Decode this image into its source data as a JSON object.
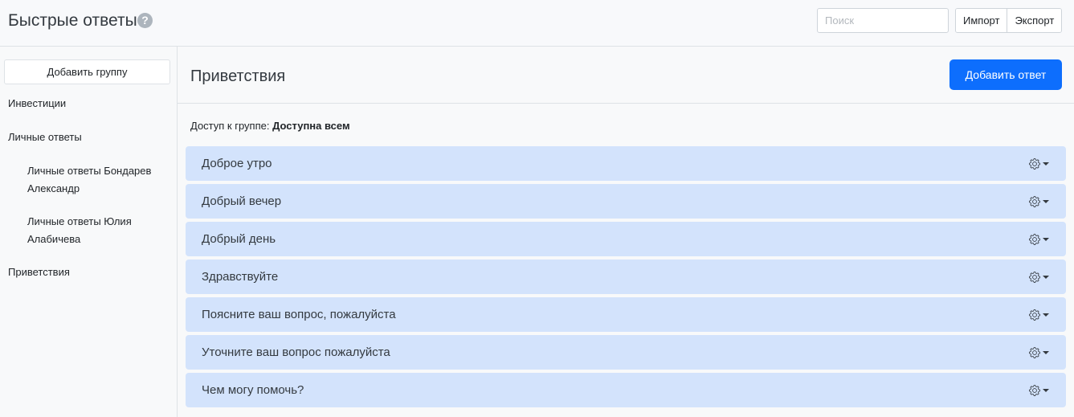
{
  "header": {
    "title": "Быстрые ответы",
    "help_icon": "question-circle-icon",
    "search_placeholder": "Поиск",
    "import_label": "Импорт",
    "export_label": "Экспорт"
  },
  "sidebar": {
    "add_group_label": "Добавить группу",
    "groups": [
      {
        "label": "Инвестиции"
      },
      {
        "label": "Личные ответы"
      },
      {
        "label": "Личные ответы Бондарев Александр"
      },
      {
        "label": "Личные ответы Юлия Алабичева"
      },
      {
        "label": "Приветствия"
      }
    ]
  },
  "main": {
    "group_title": "Приветствия",
    "add_answer_label": "Добавить ответ",
    "access_prefix": "Доступ к группе:",
    "access_value": "Доступна всем",
    "answers": [
      {
        "label": "Доброе утро"
      },
      {
        "label": "Добрый вечер"
      },
      {
        "label": "Добрый день"
      },
      {
        "label": "Здравствуйте"
      },
      {
        "label": "Поясните ваш вопрос, пожалуйста"
      },
      {
        "label": "Уточните ваш вопрос пожалуйста"
      },
      {
        "label": "Чем могу помочь?"
      }
    ],
    "row_menu_icon": "gear-icon"
  },
  "colors": {
    "primary": "#0d6efd",
    "row_bg": "#d3e3fc"
  }
}
